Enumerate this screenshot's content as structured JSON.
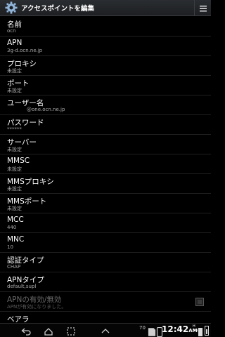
{
  "header": {
    "title": "アクセスポイントを編集",
    "menu_icon": "menu-icon",
    "settings_icon": "gear-icon"
  },
  "fields": [
    {
      "label": "名前",
      "value": "ocn"
    },
    {
      "label": "APN",
      "value": "3g-d.ocn.ne.jp"
    },
    {
      "label": "プロキシ",
      "value": "未設定"
    },
    {
      "label": "ポート",
      "value": "未設定"
    },
    {
      "label": "ユーザー名",
      "value": "@one.ocn.ne.jp"
    },
    {
      "label": "パスワード",
      "value": "******"
    },
    {
      "label": "サーバー",
      "value": "未設定"
    },
    {
      "label": "MMSC",
      "value": "未設定"
    },
    {
      "label": "MMSプロキシ",
      "value": "未設定"
    },
    {
      "label": "MMSポート",
      "value": "未設定"
    },
    {
      "label": "MCC",
      "value": "440"
    },
    {
      "label": "MNC",
      "value": "10"
    },
    {
      "label": "認証タイプ",
      "value": "CHAP"
    },
    {
      "label": "APNタイプ",
      "value": "default,supl"
    },
    {
      "label": "APNの有効/無効",
      "value": "APNが有効になりました。"
    },
    {
      "label": "ベアラ",
      "value": ""
    }
  ],
  "statusbar": {
    "notification_count": "70",
    "time": "12:42",
    "ampm": "AM",
    "network": "H",
    "network_arrows": "↑↓"
  }
}
